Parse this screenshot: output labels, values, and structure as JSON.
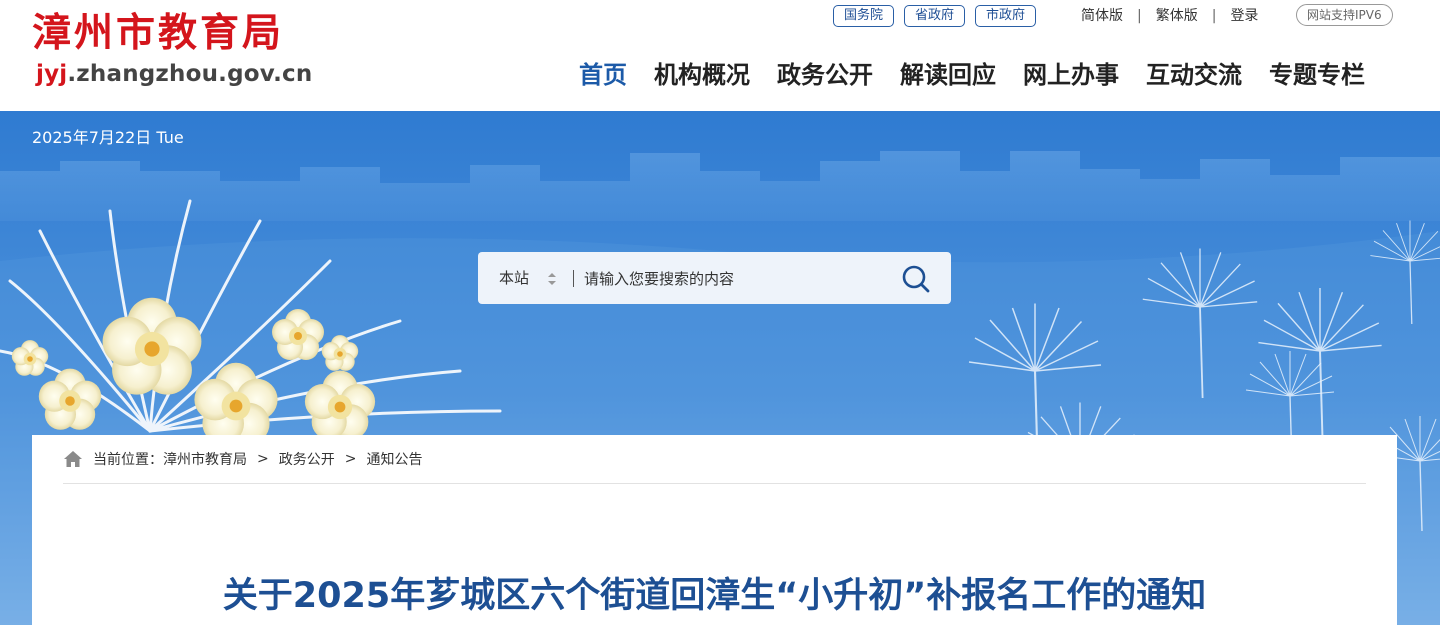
{
  "header": {
    "logo_title": "漳州市教育局",
    "logo_url_highlight": "jyj",
    "logo_url_rest": ".zhangzhou.gov.cn",
    "gov_links": [
      "国务院",
      "省政府",
      "市政府"
    ],
    "util_links": [
      "简体版",
      "繁体版",
      "登录"
    ],
    "util_separator": "|",
    "ipv6_badge": "网站支持IPV6",
    "nav": [
      {
        "label": "首页",
        "active": true
      },
      {
        "label": "机构概况",
        "active": false
      },
      {
        "label": "政务公开",
        "active": false
      },
      {
        "label": "解读回应",
        "active": false
      },
      {
        "label": "网上办事",
        "active": false
      },
      {
        "label": "互动交流",
        "active": false
      },
      {
        "label": "专题专栏",
        "active": false
      }
    ]
  },
  "banner": {
    "date": "2025年7月22日 Tue",
    "search": {
      "scope": "本站",
      "placeholder": "请输入您要搜索的内容",
      "button_icon": "search-icon"
    }
  },
  "breadcrumb": {
    "icon": "home-icon",
    "prefix": "当前位置：",
    "items": [
      "漳州市教育局",
      "政务公开",
      "通知公告"
    ],
    "separator": ">"
  },
  "article": {
    "title": "关于2025年芗城区六个街道回漳生“小升初”补报名工作的通知"
  },
  "colors": {
    "brand_red": "#d4151c",
    "nav_active": "#1c5aa8",
    "title_blue": "#1d4f93",
    "banner_blue": "#3e86d4"
  }
}
